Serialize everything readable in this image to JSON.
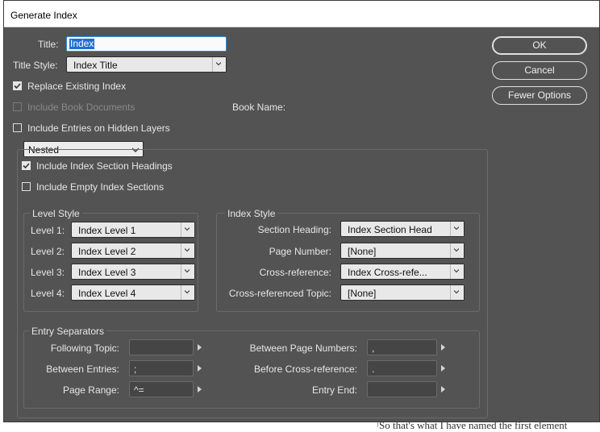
{
  "window": {
    "title": "Generate Index"
  },
  "form": {
    "title_label": "Title:",
    "title_value": "Index",
    "title_style_label": "Title Style:",
    "title_style_value": "Index Title",
    "replace_existing_label": "Replace Existing Index",
    "replace_existing_checked": true,
    "include_book_docs_label": "Include Book Documents",
    "include_book_docs_enabled": false,
    "book_name_label": "Book Name:",
    "include_hidden_layers_label": "Include Entries on Hidden Layers",
    "include_hidden_layers_checked": false,
    "format_select": "Nested",
    "section_headings_label": "Include Index Section Headings",
    "section_headings_checked": true,
    "empty_sections_label": "Include Empty Index Sections",
    "empty_sections_checked": false
  },
  "level_style": {
    "title": "Level Style",
    "levels": [
      {
        "label": "Level 1:",
        "value": "Index Level 1"
      },
      {
        "label": "Level 2:",
        "value": "Index Level 2"
      },
      {
        "label": "Level 3:",
        "value": "Index Level 3"
      },
      {
        "label": "Level 4:",
        "value": "Index Level 4"
      }
    ]
  },
  "index_style": {
    "title": "Index Style",
    "rows": [
      {
        "label": "Section Heading:",
        "value": "Index Section Head"
      },
      {
        "label": "Page Number:",
        "value": "[None]"
      },
      {
        "label": "Cross-reference:",
        "value": "Index Cross-refe..."
      },
      {
        "label": "Cross-referenced Topic:",
        "value": "[None]"
      }
    ]
  },
  "entry_separators": {
    "title": "Entry Separators",
    "left": [
      {
        "label": "Following Topic:",
        "value": ""
      },
      {
        "label": "Between Entries:",
        "value": ";"
      },
      {
        "label": "Page Range:",
        "value": "^="
      }
    ],
    "right": [
      {
        "label": "Between Page Numbers:",
        "value": ","
      },
      {
        "label": "Before Cross-reference:",
        "value": "."
      },
      {
        "label": "Entry End:",
        "value": ""
      }
    ]
  },
  "buttons": {
    "ok": "OK",
    "cancel": "Cancel",
    "fewer_options": "Fewer Options"
  },
  "background_document": {
    "bottom_text": "So that's what I have named the first element"
  },
  "colors": {
    "dialog_bg": "#535353",
    "focus_blue": "#2f8fe6",
    "selection_blue": "#1f6fd0"
  }
}
